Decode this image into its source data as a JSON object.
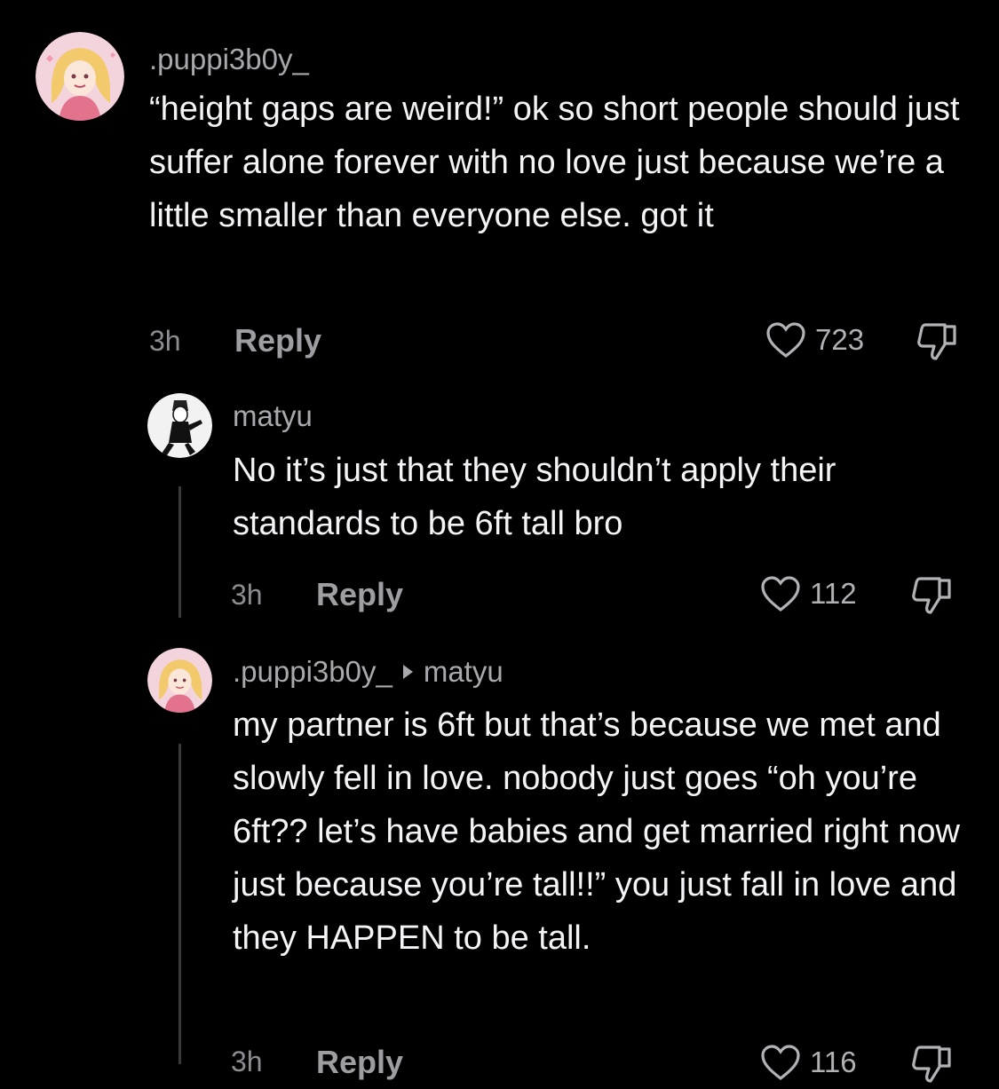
{
  "comments": [
    {
      "username": ".puppi3b0y_",
      "text": "“height gaps are weird!” ok so short people should just suffer alone forever with no love just because we’re a little smaller than everyone else. got it",
      "time": "3h",
      "reply_label": "Reply",
      "likes": "723",
      "avatar": "pink-anime-avatar"
    },
    {
      "username": "matyu",
      "text": "No it’s just that they shouldn’t apply their standards to be 6ft tall bro",
      "time": "3h",
      "reply_label": "Reply",
      "likes": "112",
      "avatar": "bw-anime-avatar"
    },
    {
      "username": ".puppi3b0y_",
      "reply_to": "matyu",
      "text": "my partner is 6ft but that’s because we met and slowly fell in love. nobody just goes “oh you’re 6ft?? let’s have babies and get married right now just because you’re tall!!” you just fall in love and they HAPPEN to be tall.",
      "time": "3h",
      "reply_label": "Reply",
      "likes": "116",
      "avatar": "pink-anime-avatar"
    }
  ],
  "icons": {
    "like": "heart-outline-icon",
    "dislike": "thumbs-down-outline-icon",
    "reply_arrow": "play-triangle-icon"
  },
  "colors": {
    "background": "#000000",
    "text": "#f4f4f6",
    "username": "#a9a9ad",
    "muted": "#8d8d91"
  }
}
